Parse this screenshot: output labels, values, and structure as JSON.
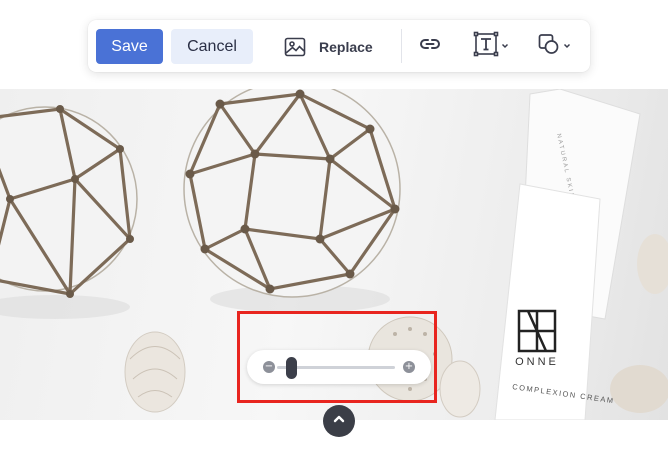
{
  "toolbar": {
    "save_label": "Save",
    "cancel_label": "Cancel",
    "replace_label": "Replace",
    "icons": {
      "replace": "image-icon",
      "link": "link-icon",
      "text": "text-icon",
      "shape": "shape-icon"
    }
  },
  "photo": {
    "product_brand": "ONNE",
    "product_name": "COMPLEXION CREAM",
    "bottle_label": "NATURAL SKIN CARE"
  },
  "zoom": {
    "value": 0.12,
    "decrease_icon": "minus-icon",
    "increase_icon": "plus-icon"
  },
  "collapse": {
    "icon": "chevron-up-icon"
  },
  "colors": {
    "primary": "#4a72d6",
    "secondary_bg": "#e8eefa",
    "highlight": "#e8251f",
    "dark": "#3b3e47"
  }
}
